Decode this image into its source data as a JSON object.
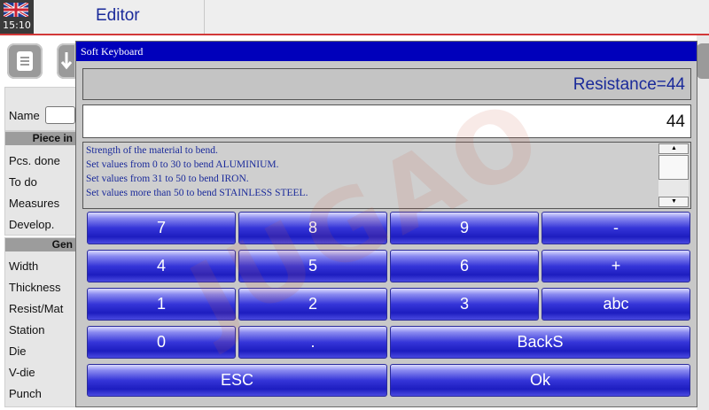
{
  "status": {
    "clock": "15:10"
  },
  "app": {
    "title": "Editor"
  },
  "background_form": {
    "name_label": "Name",
    "piece_section": "Piece in",
    "piece_fields": [
      "Pcs. done",
      "To do",
      "Measures",
      "Develop."
    ],
    "general_section": "Gen",
    "general_fields": [
      "Width",
      "Thickness",
      "Resist/Mat",
      "Station",
      "Die",
      "V-die",
      "Punch"
    ]
  },
  "dialog": {
    "title": "Soft Keyboard",
    "result": "Resistance=44",
    "entry_value": "44",
    "help_lines": [
      "Strength of the material to bend.",
      "Set values from 0 to 30 to bend ALUMINIUM.",
      "Set values from 31 to 50 to bend IRON.",
      "Set values more than 50 to bend STAINLESS STEEL."
    ],
    "keys": {
      "k7": "7",
      "k8": "8",
      "k9": "9",
      "minus": "-",
      "k4": "4",
      "k5": "5",
      "k6": "6",
      "plus": "+",
      "k1": "1",
      "k2": "2",
      "k3": "3",
      "abc": "abc",
      "k0": "0",
      "dot": ".",
      "backspace": "BackS",
      "esc": "ESC",
      "ok": "Ok"
    }
  },
  "watermark": "JUGAO",
  "colors": {
    "accent_red": "#d23838",
    "dialog_title": "#0000bb",
    "text_blue": "#1a2a9a"
  },
  "icons": [
    "uk-flag-icon",
    "document-icon",
    "download-arrow-icon",
    "scroll-up-icon",
    "scroll-down-icon"
  ]
}
